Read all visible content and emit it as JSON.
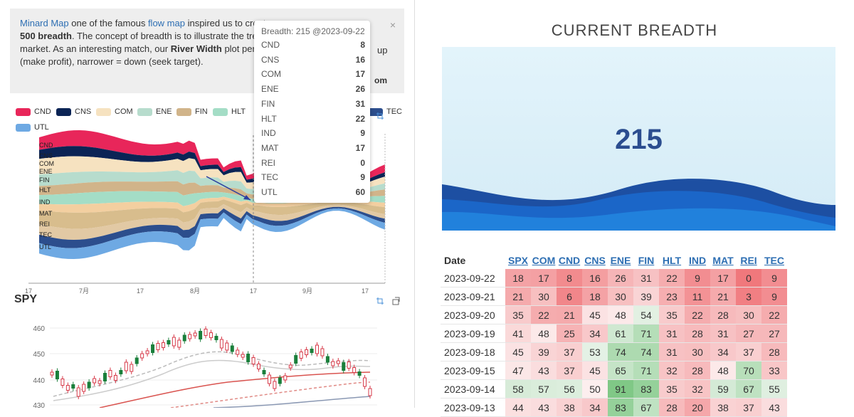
{
  "note": {
    "line1": {
      "link1": "Minard Map",
      "t1": " one of the famous ",
      "link2": "flow map",
      "t2": " inspired us to create"
    },
    "line2": {
      "bold": "500 breadth",
      "t": ". The concept of breadth is to illustrate the trend"
    },
    "line3": {
      "t1": "market. As an interesting match, our ",
      "bold": "River Width",
      "t2": " plot perfect",
      "tail": "up"
    },
    "line4": "(make profit), narrower = down (seek target).",
    "line5_tail": "om",
    "close": "×"
  },
  "legend": [
    {
      "label": "CND",
      "color": "#e8265a"
    },
    {
      "label": "CNS",
      "color": "#0b2455"
    },
    {
      "label": "COM",
      "color": "#f6e2c0"
    },
    {
      "label": "ENE",
      "color": "#b7dccd"
    },
    {
      "label": "FIN",
      "color": "#d1b48a"
    },
    {
      "label": "HLT",
      "color": "#a4ddc6"
    },
    {
      "label": "TEC",
      "color": "#2c4e8d"
    },
    {
      "label": "UTL",
      "color": "#6ea9e3"
    }
  ],
  "stream": {
    "axis_labels": [
      "CND",
      "CNS",
      "COM",
      "ENE",
      "FIN",
      "HLT",
      "IND",
      "MAT",
      "REI",
      "TEC",
      "UTL"
    ],
    "x_ticks": [
      "17",
      "7月",
      "17",
      "8月",
      "17",
      "9月",
      "17"
    ]
  },
  "tooltip": {
    "title": "Breadth: 215 @2023-09-22",
    "rows": [
      {
        "k": "CND",
        "v": "8"
      },
      {
        "k": "CNS",
        "v": "16"
      },
      {
        "k": "COM",
        "v": "17"
      },
      {
        "k": "ENE",
        "v": "26"
      },
      {
        "k": "FIN",
        "v": "31"
      },
      {
        "k": "HLT",
        "v": "22"
      },
      {
        "k": "IND",
        "v": "9"
      },
      {
        "k": "MAT",
        "v": "17"
      },
      {
        "k": "REI",
        "v": "0"
      },
      {
        "k": "TEC",
        "v": "9"
      },
      {
        "k": "UTL",
        "v": "60"
      }
    ]
  },
  "spy": {
    "title": "SPY",
    "y_ticks": [
      "460",
      "450",
      "440",
      "430"
    ]
  },
  "breadth": {
    "title": "CURRENT BREADTH",
    "value": "215"
  },
  "table": {
    "date_header": "Date",
    "columns": [
      "SPX",
      "COM",
      "CND",
      "CNS",
      "ENE",
      "FIN",
      "HLT",
      "IND",
      "MAT",
      "REI",
      "TEC"
    ],
    "rows": [
      {
        "date": "2023-09-22",
        "vals": [
          18,
          17,
          8,
          16,
          26,
          31,
          22,
          9,
          17,
          0,
          9
        ]
      },
      {
        "date": "2023-09-21",
        "vals": [
          21,
          30,
          6,
          18,
          30,
          39,
          23,
          11,
          21,
          3,
          9
        ]
      },
      {
        "date": "2023-09-20",
        "vals": [
          35,
          22,
          21,
          45,
          48,
          54,
          35,
          22,
          28,
          30,
          22
        ]
      },
      {
        "date": "2023-09-19",
        "vals": [
          41,
          48,
          25,
          34,
          61,
          71,
          31,
          28,
          31,
          27,
          27
        ]
      },
      {
        "date": "2023-09-18",
        "vals": [
          45,
          39,
          37,
          53,
          74,
          74,
          31,
          30,
          34,
          37,
          28
        ]
      },
      {
        "date": "2023-09-15",
        "vals": [
          47,
          43,
          37,
          45,
          65,
          71,
          32,
          28,
          48,
          70,
          33
        ]
      },
      {
        "date": "2023-09-14",
        "vals": [
          58,
          57,
          56,
          50,
          91,
          83,
          35,
          32,
          59,
          67,
          55
        ]
      },
      {
        "date": "2023-09-13",
        "vals": [
          44,
          43,
          38,
          34,
          83,
          67,
          28,
          20,
          38,
          37,
          43
        ]
      }
    ]
  }
}
